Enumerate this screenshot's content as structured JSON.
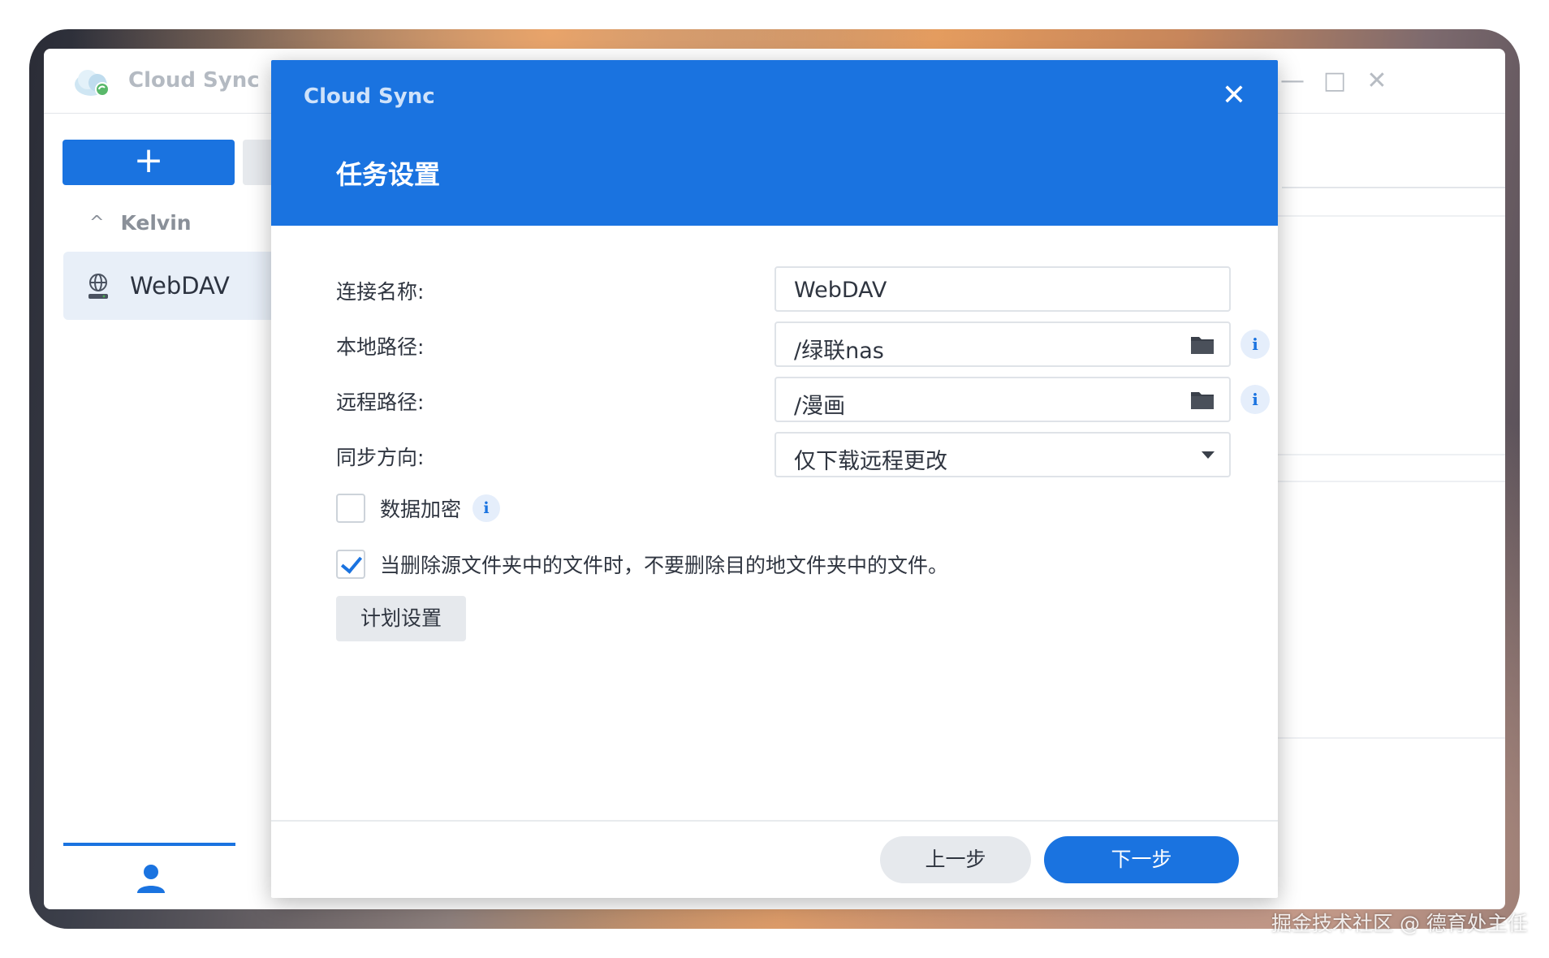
{
  "app": {
    "title": "Cloud Sync",
    "window_controls": {
      "help": "?",
      "minimize": "—",
      "maximize": "□",
      "close": "✕"
    }
  },
  "sidebar": {
    "add_label": "+",
    "group_chevron": "^",
    "group_name": "Kelvin",
    "connection_label": "WebDAV"
  },
  "dialog": {
    "app_name": "Cloud Sync",
    "close_label": "✕",
    "title": "任务设置",
    "fields": {
      "connection_name": {
        "label": "连接名称:",
        "value": "WebDAV"
      },
      "local_path": {
        "label": "本地路径:",
        "value": "/绿联nas"
      },
      "remote_path": {
        "label": "远程路径:",
        "value": "/漫画"
      },
      "sync_direction": {
        "label": "同步方向:",
        "value": "仅下载远程更改"
      }
    },
    "info_glyph": "i",
    "encrypt": {
      "label": "数据加密",
      "checked": false
    },
    "no_delete": {
      "label": "当删除源文件夹中的文件时，不要删除目的地文件夹中的文件。",
      "checked": true
    },
    "schedule_label": "计划设置",
    "prev_label": "上一步",
    "next_label": "下一步"
  },
  "watermark": "掘金技术社区 @ 德育处主任",
  "colors": {
    "accent": "#1a73e0",
    "header_bg": "#1a73e0",
    "selected_item_bg": "#e8eff8"
  }
}
